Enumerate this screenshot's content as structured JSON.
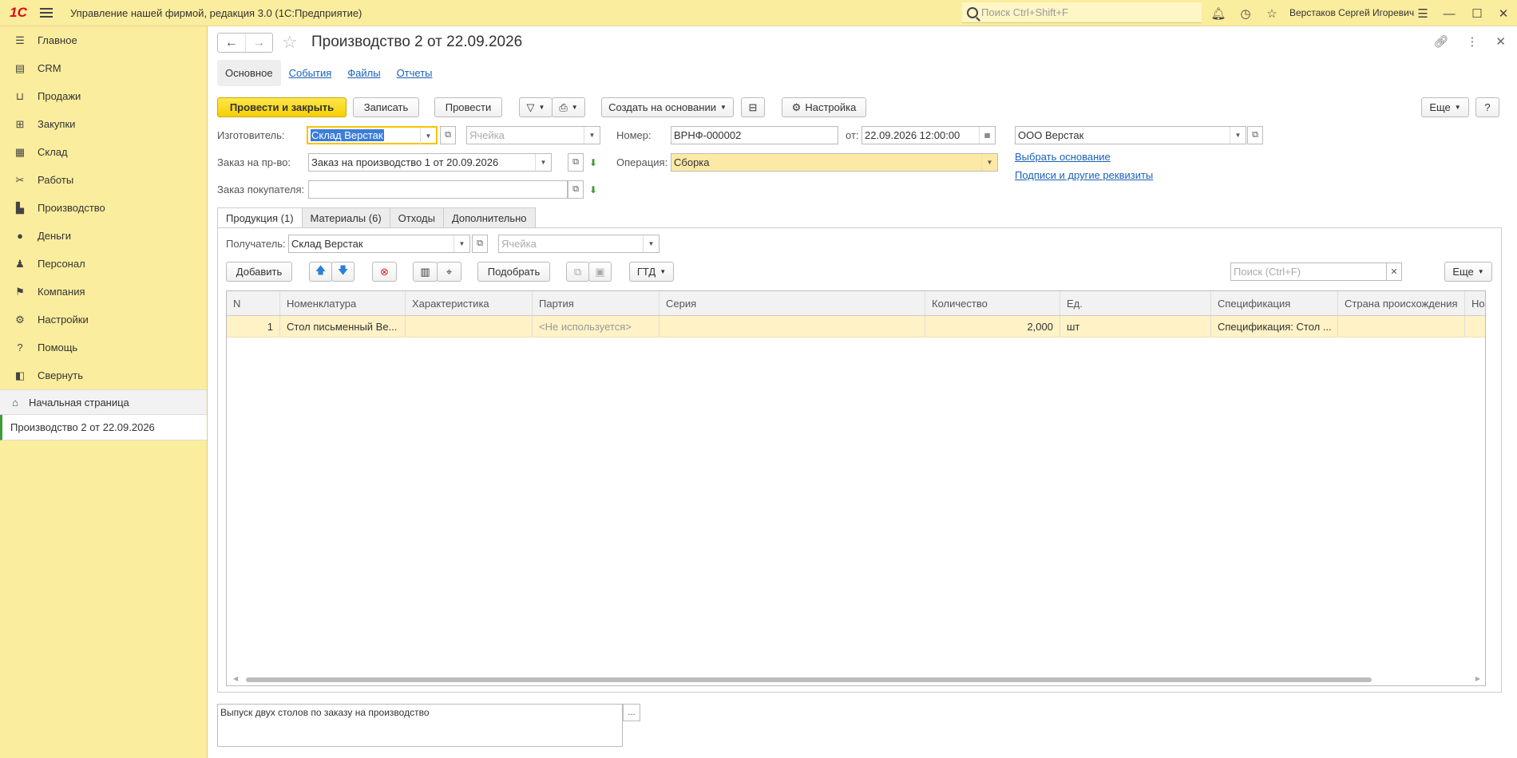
{
  "titlebar": {
    "logo": "1С",
    "app_title": "Управление нашей фирмой, редакция 3.0  (1С:Предприятие)",
    "search_placeholder": "Поиск Ctrl+Shift+F",
    "user": "Верстаков Сергей Игоревич"
  },
  "sidebar": {
    "items": [
      {
        "label": "Главное",
        "icon": "menu-list-icon"
      },
      {
        "label": "CRM",
        "icon": "crm-icon"
      },
      {
        "label": "Продажи",
        "icon": "basket-icon"
      },
      {
        "label": "Закупки",
        "icon": "purchases-icon"
      },
      {
        "label": "Склад",
        "icon": "warehouse-icon"
      },
      {
        "label": "Работы",
        "icon": "tools-icon"
      },
      {
        "label": "Производство",
        "icon": "factory-icon"
      },
      {
        "label": "Деньги",
        "icon": "money-icon"
      },
      {
        "label": "Персонал",
        "icon": "person-icon"
      },
      {
        "label": "Компания",
        "icon": "flag-icon"
      },
      {
        "label": "Настройки",
        "icon": "gear-icon"
      },
      {
        "label": "Помощь",
        "icon": "help-icon"
      },
      {
        "label": "Свернуть",
        "icon": "collapse-icon"
      }
    ],
    "home": "Начальная страница",
    "open_doc": "Производство 2 от 22.09.2026"
  },
  "doc": {
    "title": "Производство 2 от 22.09.2026",
    "tabs": [
      "Основное",
      "События",
      "Файлы",
      "Отчеты"
    ]
  },
  "toolbar": {
    "post_close": "Провести и закрыть",
    "save": "Записать",
    "post": "Провести",
    "create_based": "Создать на основании",
    "settings": "Настройка",
    "more": "Еще",
    "help": "?"
  },
  "form": {
    "maker_label": "Изготовитель:",
    "maker_value": "Склад Верстак",
    "cell_placeholder": "Ячейка",
    "number_label": "Номер:",
    "number_value": "ВРНФ-000002",
    "from_label": "от:",
    "date_value": "22.09.2026 12:00:00",
    "org_value": "ООО Верстак",
    "order_label": "Заказ на пр-во:",
    "order_value": "Заказ на производство 1 от 20.09.2026",
    "operation_label": "Операция:",
    "operation_value": "Сборка",
    "customer_order_label": "Заказ покупателя:",
    "choose_basis": "Выбрать основание",
    "signatures": "Подписи и другие реквизиты"
  },
  "inner_tabs": [
    "Продукция (1)",
    "Материалы (6)",
    "Отходы",
    "Дополнительно"
  ],
  "products": {
    "receiver_label": "Получатель:",
    "receiver_value": "Склад Верстак",
    "cell_placeholder": "Ячейка",
    "add": "Добавить",
    "pick": "Подобрать",
    "gtd": "ГТД",
    "search_placeholder": "Поиск (Ctrl+F)",
    "more": "Еще",
    "columns": [
      "N",
      "Номенклатура",
      "Характеристика",
      "Партия",
      "Серия",
      "Количество",
      "Ед.",
      "Спецификация",
      "Страна происхождения",
      "Но"
    ],
    "rows": [
      [
        "1",
        "Стол письменный Ве...",
        "",
        "<Не используется>",
        "",
        "2,000",
        "шт",
        "Спецификация: Стол ...",
        "",
        ""
      ]
    ]
  },
  "comment": "Выпуск двух столов по заказу на производство",
  "colors": {
    "accent_yellow": "#fbed9e",
    "primary_button": "#f5d000",
    "link": "#1b61b8",
    "row_highlight": "#fff2c6"
  }
}
